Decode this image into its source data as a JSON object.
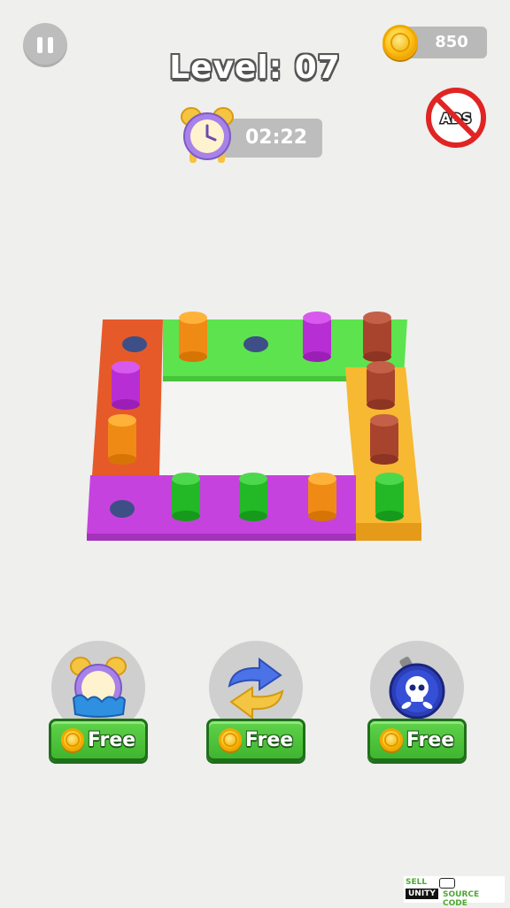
{
  "hud": {
    "coins": "850",
    "level_title": "Level: 07",
    "timer": "02:22",
    "no_ads_label": "ADS"
  },
  "boosters": [
    {
      "icon": "clock-freeze-icon",
      "label": "Free"
    },
    {
      "icon": "swap-arrows-icon",
      "label": "Free"
    },
    {
      "icon": "skull-bomb-icon",
      "label": "Free"
    }
  ],
  "colors": {
    "orange_tile": "#e65a2a",
    "green_tile": "#5de34e",
    "purple_tile": "#c642de",
    "yellow_tile": "#f7b832",
    "button_green": "#3fb52f"
  },
  "watermark": {
    "line1": "SELL",
    "line2": "UNITY",
    "line3": "SOURCE CODE"
  }
}
